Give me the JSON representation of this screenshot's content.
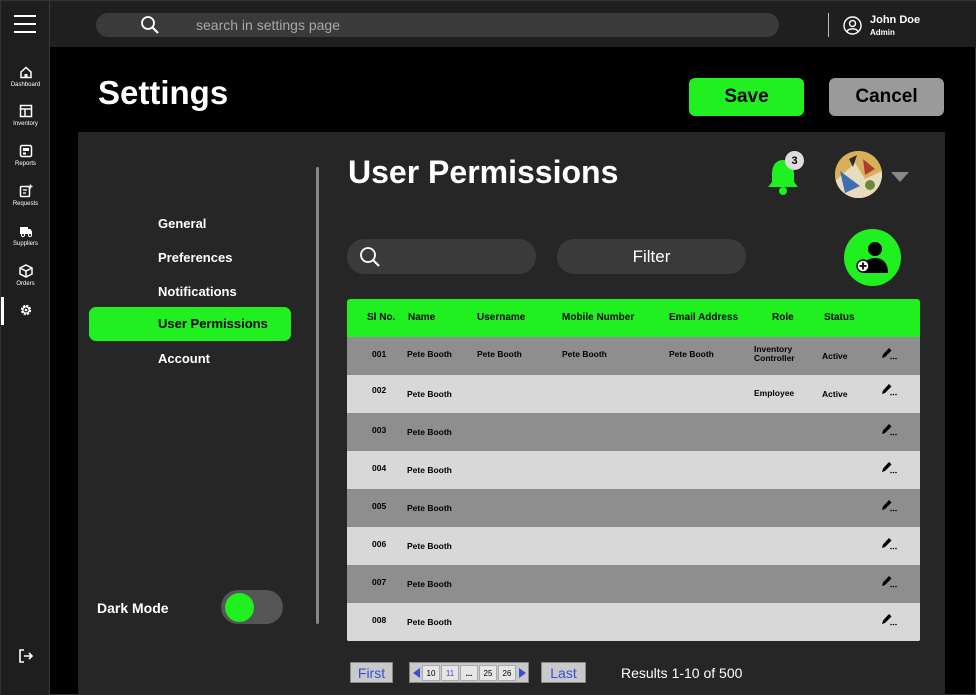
{
  "sidebar": {
    "items": [
      {
        "label": "Dashboard",
        "icon": "home-icon"
      },
      {
        "label": "Inventory",
        "icon": "inventory-icon"
      },
      {
        "label": "Reports",
        "icon": "reports-icon"
      },
      {
        "label": "Requests",
        "icon": "requests-icon"
      },
      {
        "label": "Suppliers",
        "icon": "truck-icon"
      },
      {
        "label": "Orders",
        "icon": "box-icon"
      },
      {
        "label": "",
        "icon": "gear-icon"
      }
    ]
  },
  "topbar": {
    "search_placeholder": "search in settings page",
    "user_name": "John Doe",
    "user_role": "Admin"
  },
  "header": {
    "title": "Settings",
    "save_label": "Save",
    "cancel_label": "Cancel"
  },
  "settings_nav": {
    "items": [
      "General",
      "Preferences",
      "Notifications",
      "User Permissions",
      "Account"
    ],
    "active": "User Permissions"
  },
  "dark_mode": {
    "label": "Dark Mode",
    "enabled": true
  },
  "permissions": {
    "title": "User Permissions",
    "notification_count": "3",
    "filter_label": "Filter",
    "columns": [
      "Sl No.",
      "Name",
      "Username",
      "Mobile Number",
      "Email Address",
      "Role",
      "Status"
    ],
    "rows": [
      {
        "sl": "001",
        "name": "Pete Booth",
        "username": "Pete Booth",
        "mobile": "Pete Booth",
        "email": "Pete Booth",
        "role": "Inventory Controller",
        "status": "Active"
      },
      {
        "sl": "002",
        "name": "Pete Booth",
        "username": "",
        "mobile": "",
        "email": "",
        "role": "Employee",
        "status": "Active"
      },
      {
        "sl": "003",
        "name": "Pete Booth",
        "username": "",
        "mobile": "",
        "email": "",
        "role": "",
        "status": ""
      },
      {
        "sl": "004",
        "name": "Pete Booth",
        "username": "",
        "mobile": "",
        "email": "",
        "role": "",
        "status": ""
      },
      {
        "sl": "005",
        "name": "Pete Booth",
        "username": "",
        "mobile": "",
        "email": "",
        "role": "",
        "status": ""
      },
      {
        "sl": "006",
        "name": "Pete Booth",
        "username": "",
        "mobile": "",
        "email": "",
        "role": "",
        "status": ""
      },
      {
        "sl": "007",
        "name": "Pete Booth",
        "username": "",
        "mobile": "",
        "email": "",
        "role": "",
        "status": ""
      },
      {
        "sl": "008",
        "name": "Pete Booth",
        "username": "",
        "mobile": "",
        "email": "",
        "role": "",
        "status": ""
      }
    ]
  },
  "pagination": {
    "first_label": "First",
    "last_label": "Last",
    "pages": [
      "10",
      "11",
      "...",
      "25",
      "26"
    ],
    "current_page": "11",
    "results_text": "Results 1-10 of 500"
  },
  "colors": {
    "accent": "#20f020",
    "panel": "#262626",
    "topbar": "#1f1f1f"
  }
}
